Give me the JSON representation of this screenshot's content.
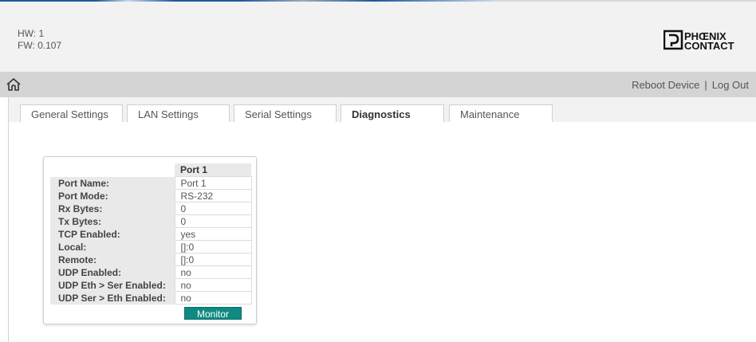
{
  "header": {
    "hw": "HW: 1",
    "fw": "FW: 0.107",
    "logo_line1": "PHŒNIX",
    "logo_line2": "CONTACT"
  },
  "navbar": {
    "home_icon": "home-icon",
    "reboot": "Reboot Device",
    "separator": "|",
    "logout": "Log Out"
  },
  "tabs": [
    {
      "label": "General Settings",
      "active": false
    },
    {
      "label": "LAN Settings",
      "active": false
    },
    {
      "label": "Serial Settings",
      "active": false
    },
    {
      "label": "Diagnostics",
      "active": true
    },
    {
      "label": "Maintenance",
      "active": false
    }
  ],
  "diagnostics": {
    "column_header": "Port 1",
    "rows": [
      {
        "label": "Port Name:",
        "value": "Port 1"
      },
      {
        "label": "Port Mode:",
        "value": "RS-232"
      },
      {
        "label": "Rx Bytes:",
        "value": "0"
      },
      {
        "label": "Tx Bytes:",
        "value": "0"
      },
      {
        "label": "TCP Enabled:",
        "value": "yes"
      },
      {
        "label": "Local:",
        "value": "[]:0"
      },
      {
        "label": "Remote:",
        "value": "[]:0"
      },
      {
        "label": "UDP Enabled:",
        "value": "no"
      },
      {
        "label": "UDP Eth > Ser Enabled:",
        "value": "no"
      },
      {
        "label": "UDP Ser > Eth Enabled:",
        "value": "no"
      }
    ],
    "monitor_label": "Monitor"
  },
  "colors": {
    "accent": "#0f8a82",
    "header_bg": "#f2f2f2",
    "navbar_bg": "#d4d4d4"
  }
}
